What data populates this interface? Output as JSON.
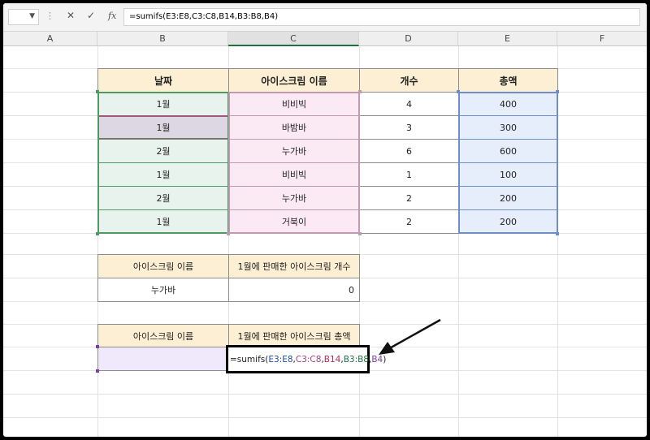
{
  "formula_bar": {
    "fx_label": "fx",
    "formula": "=sumifs(E3:E8,C3:C8,B14,B3:B8,B4)",
    "cancel_icon": "✕",
    "confirm_icon": "✓"
  },
  "columns": [
    "A",
    "B",
    "C",
    "D",
    "E",
    "F"
  ],
  "table": {
    "headers": [
      "날짜",
      "아이스크림 이름",
      "개수",
      "총액"
    ],
    "rows": [
      {
        "date": "1월",
        "name": "비비빅",
        "count": "4",
        "total": "400"
      },
      {
        "date": "1월",
        "name": "바밤바",
        "count": "3",
        "total": "300"
      },
      {
        "date": "2월",
        "name": "누가바",
        "count": "6",
        "total": "600"
      },
      {
        "date": "1월",
        "name": "비비빅",
        "count": "1",
        "total": "100"
      },
      {
        "date": "2월",
        "name": "누가바",
        "count": "2",
        "total": "200"
      },
      {
        "date": "1월",
        "name": "거북이",
        "count": "2",
        "total": "200"
      }
    ]
  },
  "summary1": {
    "label_name": "아이스크림 이름",
    "label_value": "1월에 판매한 아이스크림 개수",
    "name": "누가바",
    "value": "0"
  },
  "summary2": {
    "label_name": "아이스크림 이름",
    "label_value": "1월에 판매한 아이스크림 총액",
    "name": "",
    "formula_parts": [
      "=sumifs(",
      "E3:E8",
      ",",
      "C3:C8",
      ",",
      "B14",
      ",",
      "B3:B8",
      ",",
      "B4",
      ")"
    ]
  },
  "colors": {
    "header_fill": "#fdefd3",
    "range_e": "#6f8ec8",
    "range_c": "#c09ab1",
    "range_b": "#4f9a64",
    "accent_green": "#1e7145"
  }
}
